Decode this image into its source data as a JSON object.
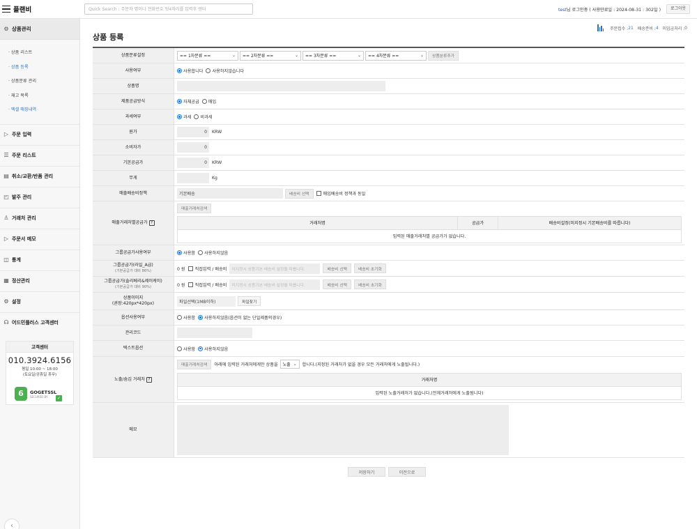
{
  "header": {
    "logo": "플랜비",
    "search_placeholder": "Quick Search : 주문자 명이나 전화번호 뒷4자리를 입력후 엔터",
    "user_name": "test",
    "user_suffix": "님 로그인중 ( 사용만료일 : 2024-08-31 : 302일 )",
    "logout": "로그아웃"
  },
  "sidebar": {
    "section_title": "상품관리",
    "sub_items": [
      "· 상품 리스트",
      "· 상품 등록",
      "· 상품분류 관리",
      "· 재고 목록",
      "· 엑셀 매칭내역"
    ],
    "items": [
      "주문 입력",
      "주문 리스트",
      "취소/교환/반품 관리",
      "발주 관리",
      "거래처 관리",
      "주문서 메모",
      "통계",
      "정산관리",
      "설정",
      "어드민플러스 고객센터"
    ],
    "cs": {
      "title": "고객센터",
      "phone": "010.3924.6156",
      "hours1": "평일 10:00 ~ 18:00",
      "hours2": "(토요일/공휴일 휴무)",
      "ssl_title": "GOGETSSL",
      "ssl_sub": "SECURED BY"
    }
  },
  "stats": {
    "orders_label": "주문접수 :",
    "orders": "21",
    "shipping_label": "배송준비 :",
    "shipping": "4",
    "unprocessed_label": "미입금처리 :",
    "unprocessed": "0"
  },
  "page_title": "상품 등록",
  "form": {
    "category": {
      "label": "상품분류설정",
      "selects": [
        "== 1차분류 ==",
        "== 2차분류 ==",
        "== 3차분류 ==",
        "== 4차분류 =="
      ],
      "add_button": "상품분류추가"
    },
    "use": {
      "label": "사용여부",
      "opt1": "사용합니다",
      "opt2": "사용하지않습니다"
    },
    "name": {
      "label": "상품명"
    },
    "supply_method": {
      "label": "제품공급방식",
      "opt1": "자체공급",
      "opt2": "매입"
    },
    "tax": {
      "label": "과세여부",
      "opt1": "과세",
      "opt2": "비과세"
    },
    "cost": {
      "label": "원가",
      "value": "0",
      "unit": "KRW"
    },
    "consumer_price": {
      "label": "소비자가",
      "value": "0"
    },
    "base_supply": {
      "label": "기본공급가",
      "value": "0",
      "unit": "KRW"
    },
    "weight": {
      "label": "무게",
      "unit": "Kg"
    },
    "shipping_policy": {
      "label": "매출배송비정책",
      "value": "기본배송",
      "button": "배송비 선택",
      "check": "매입배송비 정책과 동일"
    },
    "sales_partner": {
      "label": "매출거래처별공급가",
      "search_button": "매출거래처검색",
      "col1": "거래처명",
      "col2": "공급가",
      "col3": "배송비설정(미지정시 기본배송비를 따릅니다)",
      "empty": "입력된 매출거래처별 공급가가 없습니다."
    },
    "group_use": {
      "label": "그룹공급가사용여부",
      "opt1": "사용함",
      "opt2": "사용하지않음"
    },
    "group_a": {
      "label": "그룹공급가(라일_A급)",
      "sub": "(기본공급가 대비 86%)",
      "value": "0 원",
      "check": "직접입력 / 배송비",
      "placeholder": "미지정시 상품기본 배송비 설정을 따릅니다.",
      "btn1": "배송비 선택",
      "btn2": "배송비 초기화"
    },
    "group_b": {
      "label": "그룹공급가(솔리베리&제이케이)",
      "sub": "(기본공급가 대비 90%)",
      "value": "0 원",
      "check": "직접입력 / 배송비",
      "placeholder": "미지정시 상품기본 배송비 설정을 따릅니다.",
      "btn1": "배송비 선택",
      "btn2": "배송비 초기화"
    },
    "image": {
      "label": "상품이미지",
      "sub": "(권장:420px*420px)",
      "file": "파일선택(1MB이하)",
      "button": "파일찾기"
    },
    "option_use": {
      "label": "옵션사용여부",
      "opt1": "사용함",
      "opt2": "사용하지않음(옵션이 없는 단일제품의경우)"
    },
    "code": {
      "label": "관리코드"
    },
    "text_option": {
      "label": "텍스트옵션",
      "opt1": "사용함",
      "opt2": "사용하지않음"
    },
    "expose": {
      "label": "노출/숨김 거래처",
      "search_button": "매출거래처검색",
      "text1": "아래에 입력된 거래처에게만 상품을",
      "select": "노출",
      "text2": "합니다.(지정된 거래처가 없을 경우 모든 거래처에게 노출됩니다.)",
      "col": "거래처명",
      "empty": "입력된 노출거래처가 없습니다.(전체거래처에게 노출됨니다)"
    },
    "memo": {
      "label": "메모"
    }
  },
  "actions": {
    "save": "저장하기",
    "back": "이전으로"
  },
  "colors": {
    "accent": "#2a78c8",
    "radio_on": "#1a73e8",
    "label_bg": "#f0f0f0"
  }
}
